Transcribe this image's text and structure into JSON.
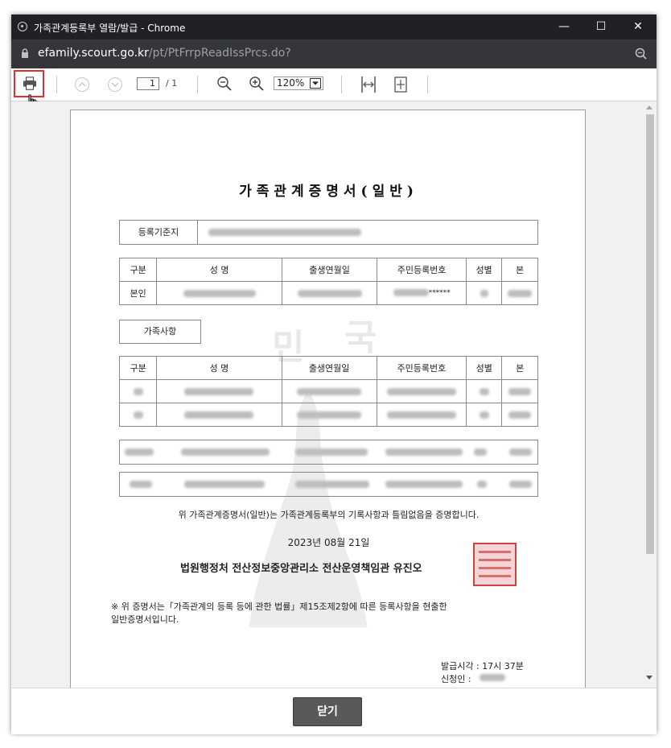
{
  "window": {
    "title": "가족관계등록부 열람/발급 - Chrome",
    "minimize": "—",
    "maximize": "☐",
    "close": "✕"
  },
  "urlbar": {
    "host": "efamily.scourt.go.kr",
    "path": "/pt/PtFrrpReadIssPrcs.do?"
  },
  "toolbar": {
    "page_current": "1",
    "page_total": "/ 1",
    "zoom": "120%"
  },
  "document": {
    "title": "가족관계증명서(일반)",
    "reg_label": "등록기준지",
    "self_table": {
      "headers": [
        "구분",
        "성    명",
        "출생연월일",
        "주민등록번호",
        "성별",
        "본"
      ],
      "row_label": "본인",
      "rrn_suffix": "******"
    },
    "family_label": "가족사항",
    "family_table": {
      "headers": [
        "구분",
        "성    명",
        "출생연월일",
        "주민등록번호",
        "성별",
        "본"
      ]
    },
    "certify_text": "위 가족관계증명서(일반)는 가족관계등록부의 기록사항과 틀림없음을 증명합니다.",
    "date": "2023년 08월 21일",
    "issuer": "법원행정처 전산정보중앙관리소 전산운영책임관 유진오",
    "note_line1": "※ 위 증명서는「가족관계의 등록 등에 관한 법률」제15조제2항에 따른 등록사항을 현출한",
    "note_line2": "일반증명서입니다.",
    "issue_time": "발급시각 : 17시 37분",
    "applicant_label": "신청인 :"
  },
  "footer": {
    "close_label": "닫기"
  },
  "colors": {
    "titlebar": "#202124",
    "urlbar": "#35363a",
    "highlight": "#e03030",
    "button": "#595959"
  }
}
